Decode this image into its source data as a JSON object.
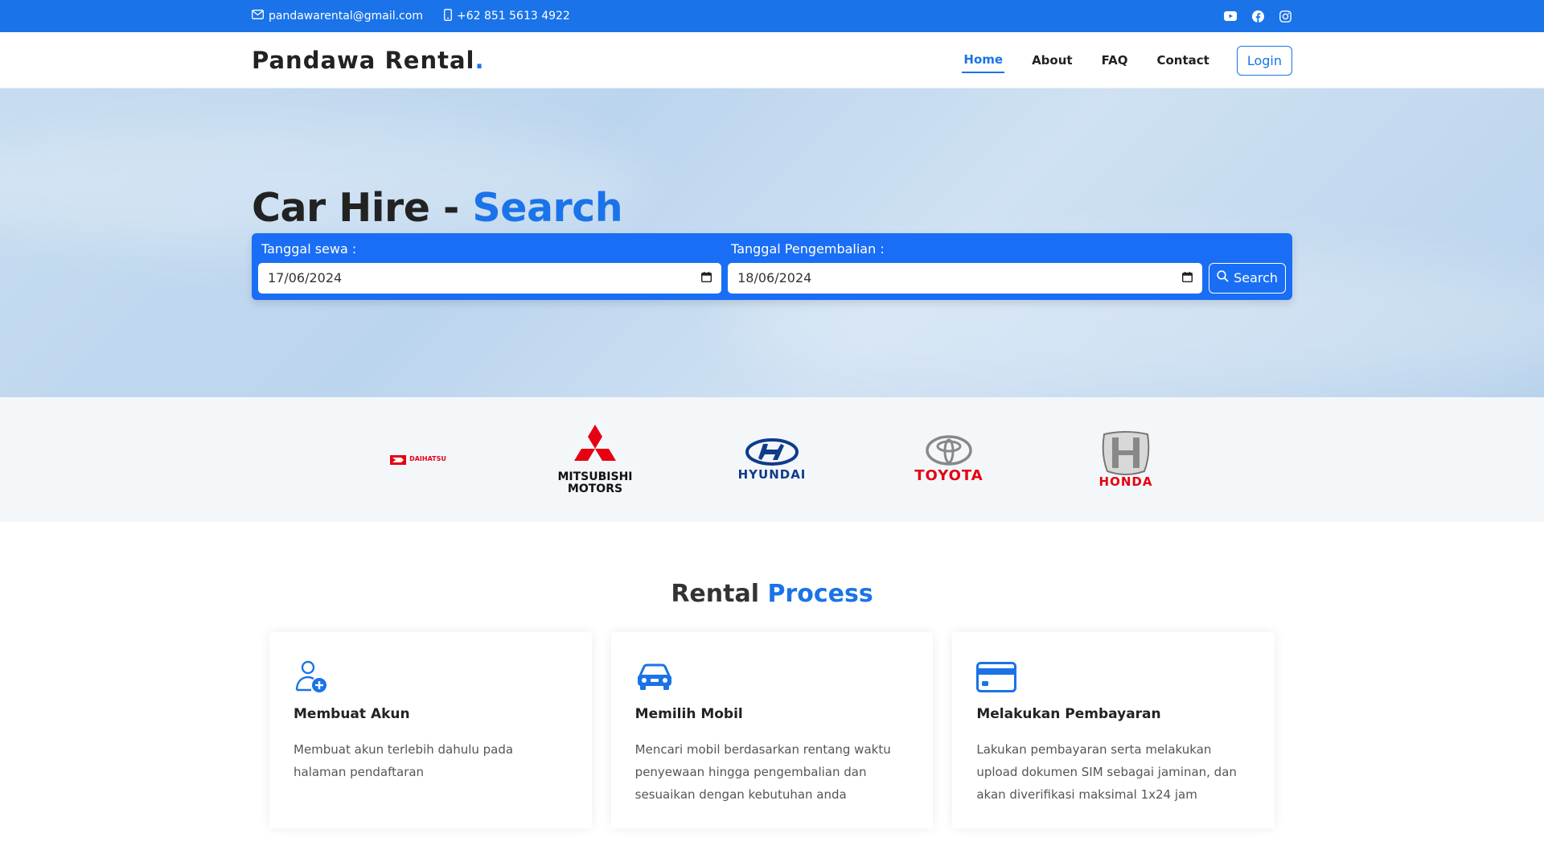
{
  "topbar": {
    "email": "pandawarental@gmail.com",
    "phone": "+62 851 5613 4922",
    "social_icons": [
      "youtube-icon",
      "facebook-icon",
      "instagram-icon"
    ]
  },
  "navbar": {
    "brand": "Pandawa Rental",
    "brand_dot": ".",
    "links": [
      {
        "label": "Home",
        "active": true
      },
      {
        "label": "About",
        "active": false
      },
      {
        "label": "FAQ",
        "active": false
      },
      {
        "label": "Contact",
        "active": false
      }
    ],
    "login_label": "Login"
  },
  "hero": {
    "title_main": "Car Hire - ",
    "title_accent": "Search",
    "rent_date_label": "Tanggal sewa :",
    "rent_date_value": "17/06/2024",
    "return_date_label": "Tanggal Pengembalian :",
    "return_date_value": "18/06/2024",
    "search_label": "Search"
  },
  "brands": [
    {
      "name": "DAIHATSU",
      "icon": "daihatsu-logo",
      "color": "#e60012"
    },
    {
      "name": "MITSUBISHI MOTORS",
      "icon": "mitsubishi-logo",
      "color": "#e60012"
    },
    {
      "name": "HYUNDAI",
      "icon": "hyundai-logo",
      "color": "#0f3c8a"
    },
    {
      "name": "TOYOTA",
      "icon": "toyota-logo",
      "color": "#e60012"
    },
    {
      "name": "HONDA",
      "icon": "honda-logo",
      "color": "#e60012"
    }
  ],
  "process": {
    "title_main": "Rental ",
    "title_accent": "Process",
    "cards": [
      {
        "icon": "user-plus-icon",
        "title": "Membuat Akun",
        "text": "Membuat akun terlebih dahulu pada halaman pendaftaran"
      },
      {
        "icon": "car-icon",
        "title": "Memilih Mobil",
        "text": "Mencari mobil berdasarkan rentang waktu penyewaan hingga pengembalian dan sesuaikan dengan kebutuhan anda"
      },
      {
        "icon": "credit-card-icon",
        "title": "Melakukan Pembayaran",
        "text": "Lakukan pembayaran serta melakukan upload dokumen SIM sebagai jaminan, dan akan diverifikasi maksimal 1x24 jam"
      }
    ]
  },
  "colors": {
    "primary": "#1a73e8",
    "search_box": "#1a6ef5",
    "brands_bg": "#f4f7fa"
  }
}
